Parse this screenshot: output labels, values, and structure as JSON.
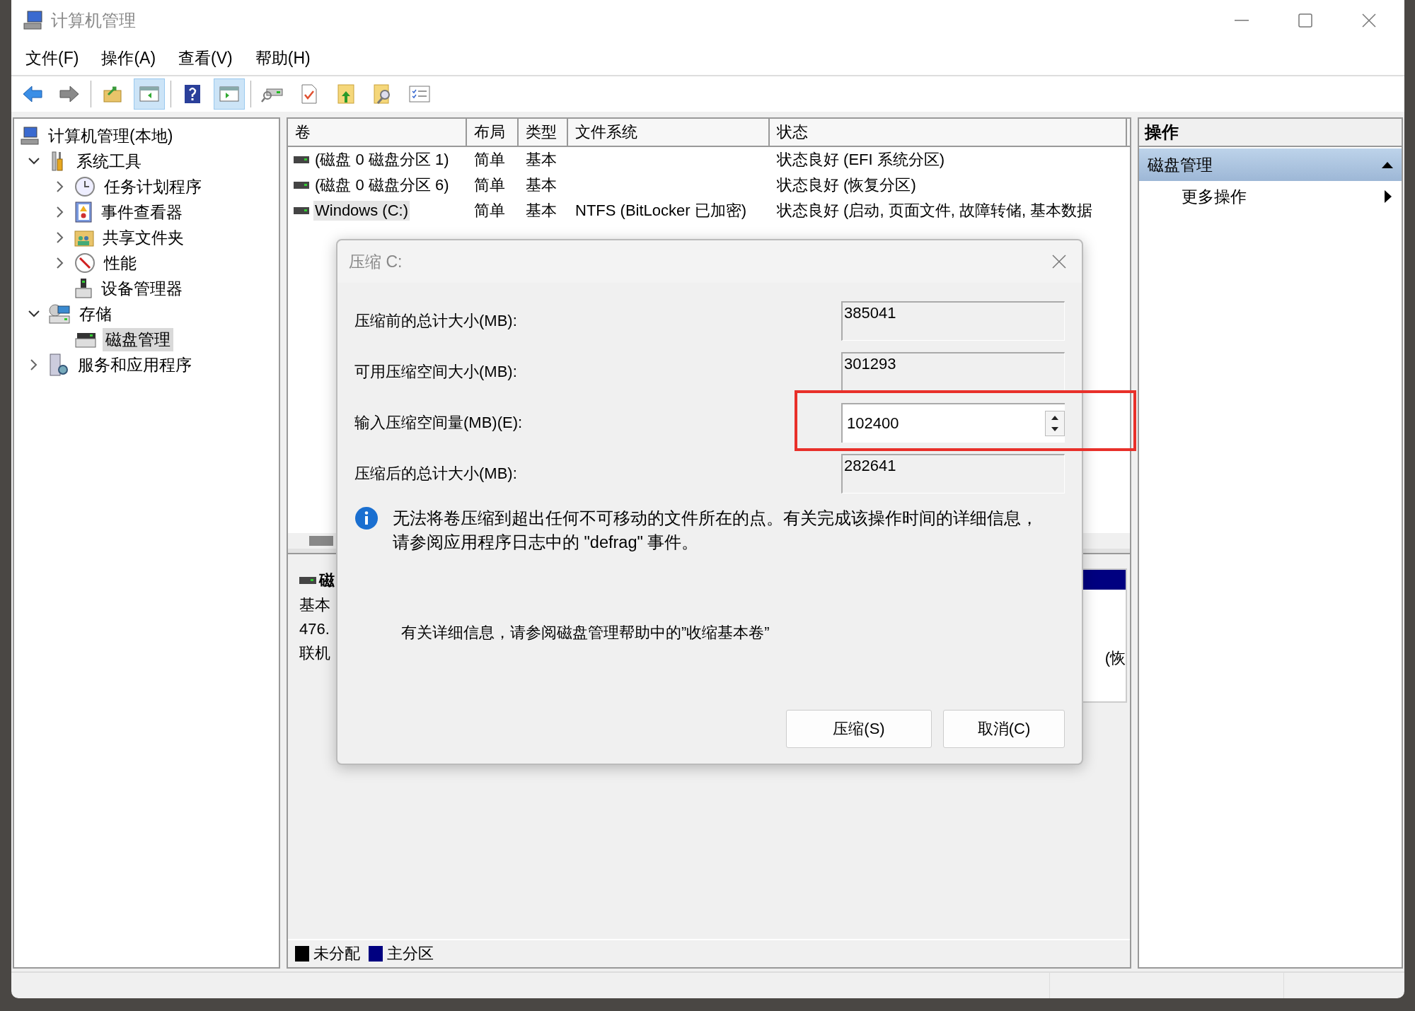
{
  "window": {
    "title": "计算机管理"
  },
  "menu": [
    "文件(F)",
    "操作(A)",
    "查看(V)",
    "帮助(H)"
  ],
  "toolbar": [
    {
      "pressed": false
    },
    {
      "pressed": false
    },
    {
      "pressed": false
    },
    {
      "pressed": true
    },
    {
      "pressed": false
    },
    {
      "pressed": true
    },
    {
      "pressed": false
    },
    {
      "pressed": false
    },
    {
      "pressed": false
    },
    {
      "pressed": false
    },
    {
      "pressed": false
    }
  ],
  "tree": [
    {
      "label": "计算机管理(本地)",
      "selected": false,
      "children": [
        {
          "label": "系统工具",
          "expanded": true,
          "selected": false,
          "children": [
            {
              "label": "任务计划程序",
              "expanded": false,
              "selected": false
            },
            {
              "label": "事件查看器",
              "expanded": false,
              "selected": false
            },
            {
              "label": "共享文件夹",
              "expanded": false,
              "selected": false
            },
            {
              "label": "性能",
              "expanded": false,
              "selected": false
            },
            {
              "label": "设备管理器",
              "selected": false
            }
          ]
        },
        {
          "label": "存储",
          "expanded": true,
          "selected": false,
          "children": [
            {
              "label": "磁盘管理",
              "selected": true
            }
          ]
        },
        {
          "label": "服务和应用程序",
          "expanded": false,
          "selected": false
        }
      ]
    }
  ],
  "table": {
    "columns": [
      "卷",
      "布局",
      "类型",
      "文件系统",
      "状态"
    ],
    "rows": [
      {
        "selected": false,
        "cells": [
          "(磁盘 0 磁盘分区 1)",
          "简单",
          "基本",
          "",
          "状态良好 (EFI 系统分区)"
        ]
      },
      {
        "selected": false,
        "cells": [
          "(磁盘 0 磁盘分区 6)",
          "简单",
          "基本",
          "",
          "状态良好 (恢复分区)"
        ]
      },
      {
        "selected": true,
        "cells": [
          "Windows (C:)",
          "简单",
          "基本",
          "NTFS (BitLocker 已加密)",
          "状态良好 (启动, 页面文件, 故障转储, 基本数据"
        ]
      }
    ]
  },
  "disk": {
    "name": "磁",
    "lines": [
      "基本",
      "476.",
      "联机"
    ],
    "partition_text": "(恢"
  },
  "legend": [
    {
      "label": "未分配",
      "color": "#000000"
    },
    {
      "label": "主分区",
      "color": "#000080"
    }
  ],
  "actions": {
    "title": "操作",
    "sections": [
      {
        "label": "磁盘管理",
        "expanded": true,
        "items": [
          "更多操作"
        ]
      }
    ]
  },
  "dialog": {
    "title": "压缩 C:",
    "fields": [
      {
        "label": "压缩前的总计大小(MB):",
        "value": "385041",
        "kind": "readonly",
        "highlighted": false
      },
      {
        "label": "可用压缩空间大小(MB):",
        "value": "301293",
        "kind": "readonly",
        "highlighted": false
      },
      {
        "label": "输入压缩空间量(MB)(E):",
        "value": "102400",
        "kind": "spin",
        "highlighted": true
      },
      {
        "label": "压缩后的总计大小(MB):",
        "value": "282641",
        "kind": "readonly",
        "highlighted": false
      }
    ],
    "info": "无法将卷压缩到超出任何不可移动的文件所在的点。有关完成该操作时间的详细信息，请参阅应用程序日志中的 \"defrag\" 事件。",
    "note": "有关详细信息，请参阅磁盘管理帮助中的”收缩基本卷”",
    "buttons": [
      "压缩(S)",
      "取消(C)"
    ]
  }
}
